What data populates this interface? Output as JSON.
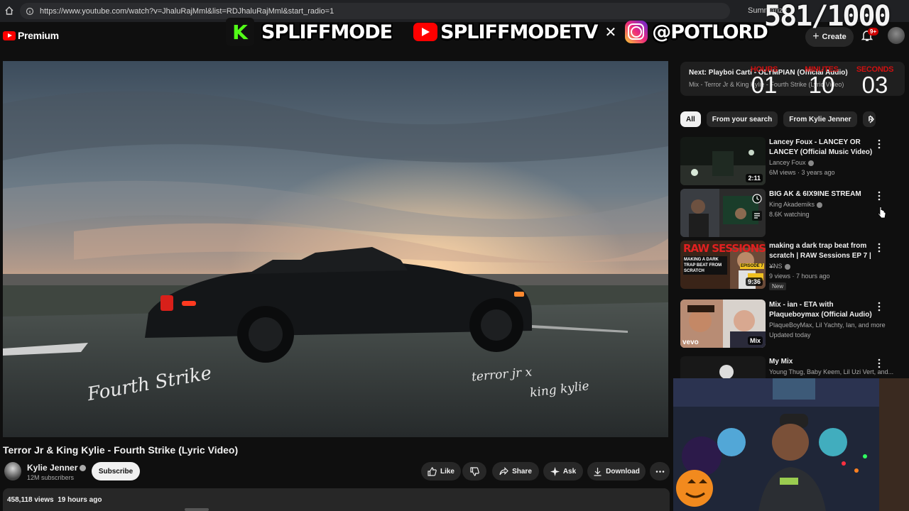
{
  "browser": {
    "url": "https://www.youtube.com/watch?v=JhaluRajMml&list=RDJhaluRajMml&start_radio=1",
    "summarize": "Summarize"
  },
  "header": {
    "logo_text": "Premium",
    "create_label": "Create",
    "notification_count": "9+"
  },
  "overlay": {
    "kick_letter": "K",
    "kick_handle": "SPLIFFMODE",
    "youtube_handle": "SPLIFFMODETV",
    "instagram_handle": "@POTLORD",
    "counter": "581/1000"
  },
  "video": {
    "title": "Terror Jr & King Kylie - Fourth Strike (Lyric Video)",
    "signature_left": "Fourth Strike",
    "signature_right_1": "terror jr x",
    "signature_right_2": "king kylie"
  },
  "channel": {
    "name": "Kylie Jenner",
    "subscribers": "12M subscribers",
    "subscribe_label": "Subscribe"
  },
  "actions": {
    "like": "Like",
    "share": "Share",
    "ask": "Ask",
    "download": "Download"
  },
  "description": {
    "views": "458,118 views",
    "age": "19 hours ago"
  },
  "next_up": {
    "label": "Next: Playboi Carti - OLYMPIAN (Official Audio)",
    "playlist": "Mix - Terror Jr & King Kylie - Fourth Strike (Lyric Video)"
  },
  "timer": {
    "hours_label": "HOURS",
    "hours": "01",
    "minutes_label": "MINUTES",
    "minutes": "10",
    "seconds_label": "SECONDS",
    "seconds": "03"
  },
  "chips": [
    "All",
    "From your search",
    "From Kylie Jenner",
    "R"
  ],
  "recommendations": [
    {
      "title": "Lancey Foux - LANCEY OR LANCEY (Official Music Video)",
      "channel": "Lancey Foux",
      "meta": "6M views · 3 years ago",
      "duration": "2:11"
    },
    {
      "title": "BIG AK & 6IX9INE STREAM",
      "channel": "King Akademiks",
      "meta": "8.6K watching",
      "duration": ""
    },
    {
      "title": "making a dark trap beat from scratch | RAW Sessions EP 7 | ...",
      "channel": "YNS",
      "meta": "9 views · 7 hours ago",
      "duration": "9:36",
      "badge": "New",
      "thumb_text": "RAW SESSIONS",
      "thumb_sub": "MAKING A DARK TRAP BEAT FROM SCRATCH",
      "thumb_ep": "EPISODE 7"
    },
    {
      "title": "Mix - ian - ETA with Plaqueboymax (Official Audio)",
      "channel": "PlaqueBoyMax, Lil Yachty, Ian, and more",
      "meta": "Updated today",
      "duration": "Mix",
      "thumb_text": "vevo"
    },
    {
      "title": "My Mix",
      "channel": "Young Thug, Baby Keem, Lil Uzi Vert, and...",
      "meta": "",
      "duration": ""
    }
  ],
  "colors": {
    "accent_red": "#ff0000",
    "timer_red": "#d01010",
    "background": "#0f0f0f",
    "kick_green": "#53fc18"
  }
}
